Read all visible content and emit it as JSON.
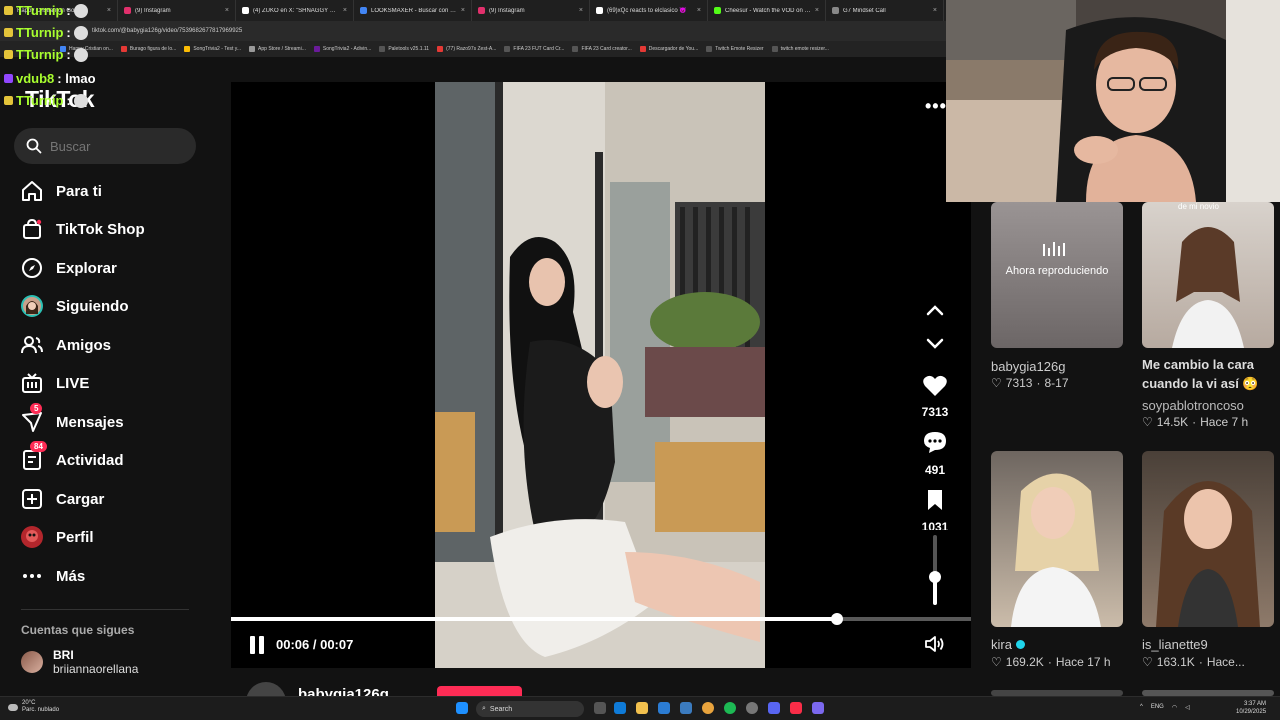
{
  "browser": {
    "tabs": [
      {
        "label": "Happy Cristian on Google",
        "color": "#4285f4"
      },
      {
        "label": "(9) Instagram",
        "color": "#e1306c"
      },
      {
        "label": "(4) ZUKO en X: \"SHNAGGY CR...",
        "color": "#ffffff"
      },
      {
        "label": "LOOKSMAXER - Buscar con Go...",
        "color": "#4285f4"
      },
      {
        "label": "(9) Instagram",
        "color": "#e1306c"
      },
      {
        "label": "(69)xQc reacts to elclasico 😈",
        "color": "#ffffff"
      },
      {
        "label": "Cheesur - Watch the VOD on K...",
        "color": "#53fc18"
      },
      {
        "label": "G7 Mindset Call",
        "color": "#888888"
      }
    ],
    "url": "tiktok.com/@babygia126g/video/7539682677817969925",
    "bookmarks": [
      "Happy Cristian on...",
      "Burago figura de lo...",
      "SongTrivia2 - Test y...",
      "App Store / Streami...",
      "SongTrivia2 - Adivin...",
      "Paletools v25.1.11",
      "(77) Razo97s Zest-A...",
      "FIFA 23 FUT Card Cr...",
      "FIFA 23 Card creator...",
      "Descargador de You...",
      "Twitch Emote Resizer",
      "twitch emote resizer..."
    ]
  },
  "chat": [
    {
      "user": "TTurnip",
      "message": ":",
      "emote": true
    },
    {
      "user": "TTurnip",
      "message": ":",
      "emote": true
    },
    {
      "user": "TTurnip",
      "message": ":",
      "emote": true
    },
    {
      "user": "vdub8",
      "message": ": lmao",
      "emote": false
    },
    {
      "user": "TTurnip",
      "message": ":",
      "emote": true
    }
  ],
  "sidebar": {
    "logo": "TikTok",
    "search_placeholder": "Buscar",
    "nav": [
      {
        "label": "Para ti",
        "icon": "home-icon",
        "badge": ""
      },
      {
        "label": "TikTok Shop",
        "icon": "shop-icon",
        "badge": ""
      },
      {
        "label": "Explorar",
        "icon": "compass-icon",
        "badge": ""
      },
      {
        "label": "Siguiendo",
        "icon": "following-avatar-icon",
        "badge": ""
      },
      {
        "label": "Amigos",
        "icon": "friends-icon",
        "badge": ""
      },
      {
        "label": "LIVE",
        "icon": "live-icon",
        "badge": ""
      },
      {
        "label": "Mensajes",
        "icon": "messages-icon",
        "badge": "5"
      },
      {
        "label": "Actividad",
        "icon": "activity-icon",
        "badge": "84"
      },
      {
        "label": "Cargar",
        "icon": "upload-icon",
        "badge": ""
      },
      {
        "label": "Perfil",
        "icon": "profile-icon",
        "badge": ""
      },
      {
        "label": "Más",
        "icon": "more-icon",
        "badge": ""
      }
    ],
    "following_title": "Cuentas que sigues",
    "following": [
      {
        "name": "BRI",
        "handle": "briiannaorellana"
      }
    ]
  },
  "player": {
    "likes": "7313",
    "comments": "491",
    "saves": "1031",
    "current_time": "00:06",
    "total_time": "00:07",
    "time_separator": " / ",
    "progress": 0.819,
    "volume": 0.4,
    "author": "babygia126g"
  },
  "feed": [
    {
      "caption": "",
      "overlay": "Ahora reproduciendo",
      "user": "babygia126g",
      "likes": "7313",
      "date": "8-17",
      "verified": false,
      "top_text": ""
    },
    {
      "caption": "Me cambio la cara",
      "caption2": "cuando la vi así 😳",
      "user": "soypablotroncoso",
      "likes": "14.5K",
      "date": "Hace 7 h",
      "verified": false,
      "top_text": "de mi novio"
    },
    {
      "caption": "",
      "user": "kira",
      "likes": "169.2K",
      "date": "Hace 17 h",
      "verified": true
    },
    {
      "caption": "",
      "user": "is_lianette9",
      "likes": "163.1K",
      "date": "Hace...",
      "verified": false
    }
  ],
  "taskbar": {
    "weather_temp": "20°C",
    "weather_desc": "Parc. nublado",
    "search_label": "Search",
    "lang": "ENG",
    "time": "3:37 AM",
    "date": "10/29/2025"
  }
}
